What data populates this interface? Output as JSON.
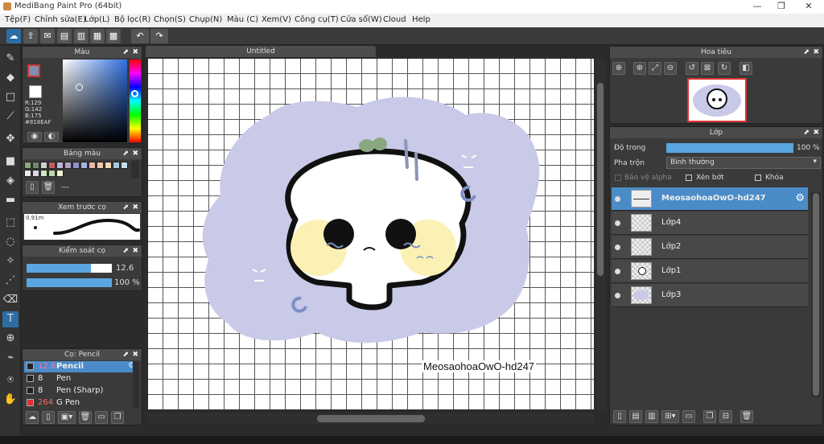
{
  "window": {
    "title": "MediBang Paint Pro (64bit)",
    "min": "—",
    "max": "❐",
    "close": "✕"
  },
  "menu": [
    "Tệp(F)",
    "Chỉnh sửa(E)",
    "Lớp(L)",
    "Bộ lọc(R)",
    "Chọn(S)",
    "Chụp(N)",
    "Màu (C)",
    "Xem(V)",
    "Công cụ(T)",
    "Cửa sổ(W)",
    "Cloud",
    "Help"
  ],
  "color_panel": {
    "title": "Màu",
    "r": "R:129",
    "g": "G:142",
    "b": "B:175",
    "hex": "#818EAF",
    "primary_color": "#818EAF"
  },
  "palette_panel": {
    "title": "Bảng màu",
    "empty_label": "---",
    "swatches": [
      "#8aa880",
      "#6e8a66",
      "#cfcfcf",
      "#c35b5b",
      "#bcb7d8",
      "#b3a0c8",
      "#8f91c9",
      "#a5b1e0",
      "#e8b8a8",
      "#efc8b0",
      "#f3d6b0",
      "#a6c9e0",
      "#c7dfe8",
      "#e3eaf0",
      "#dcd4e8",
      "#d0e8c0",
      "#b8d8a8",
      "#f0f0d0"
    ]
  },
  "brush_preview": {
    "title": "Xem trước cọ",
    "size": "0.91m"
  },
  "brush_control": {
    "title": "Kiểm soát cọ",
    "size_value": "12.6",
    "opacity_value": "100 %",
    "size_fraction": 0.75,
    "opacity_fraction": 1.0
  },
  "brush_list": {
    "title": "Cọ: Pencil",
    "items": [
      {
        "size": "12.6",
        "name": "Pencil",
        "selected": true,
        "color": "#222222"
      },
      {
        "size": "8",
        "name": "Pen",
        "selected": false,
        "color": "#222222"
      },
      {
        "size": "8",
        "name": "Pen (Sharp)",
        "selected": false,
        "color": "#222222"
      },
      {
        "size": "264",
        "name": "G Pen",
        "selected": false,
        "color": "#e03030"
      }
    ]
  },
  "document": {
    "tab": "Untitled",
    "signature": "MeosaohoaOwO-hd247"
  },
  "navigator": {
    "title": "Hoa tiêu"
  },
  "layer_panel": {
    "title": "Lớp",
    "opacity_label": "Độ trong",
    "opacity_value": "100 %",
    "opacity_fraction": 1.0,
    "blend_label": "Pha trộn",
    "blend_value": "Bình thường",
    "protect_alpha": "Bảo vệ alpha",
    "clipping": "Xén bớt",
    "lock": "Khóa",
    "layers": [
      {
        "name": "MeosaohoaOwO-hd247",
        "selected": true
      },
      {
        "name": "Lớp4",
        "selected": false
      },
      {
        "name": "Lớp2",
        "selected": false
      },
      {
        "name": "Lớp1",
        "selected": false
      },
      {
        "name": "Lớp3",
        "selected": false
      }
    ]
  }
}
